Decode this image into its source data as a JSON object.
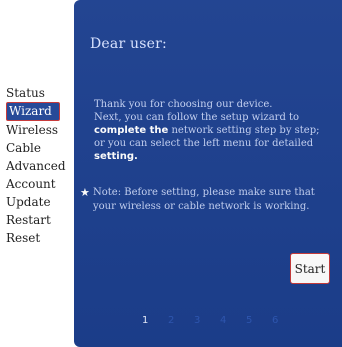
{
  "sidebar": {
    "items": [
      {
        "label": "Status"
      },
      {
        "label": "Wizard",
        "active": true
      },
      {
        "label": "Wireless"
      },
      {
        "label": "Cable"
      },
      {
        "label": "Advanced"
      },
      {
        "label": "Account"
      },
      {
        "label": "Update"
      },
      {
        "label": "Restart"
      },
      {
        "label": "Reset"
      }
    ]
  },
  "panel": {
    "greeting": "Dear user:",
    "intro": {
      "line1": "Thank you for choosing our device.",
      "line2": "Next, you can follow the setup wizard to",
      "bold1": "complete the",
      "line3_rest": " network setting step by step;",
      "line4": "or you can select the left menu for detailed",
      "bold2": "setting."
    },
    "note": {
      "icon": "star-icon",
      "text": "Note: Before setting, please make sure that your wireless or cable network is working."
    },
    "start_label": "Start",
    "pages": [
      "1",
      "2",
      "3",
      "4",
      "5",
      "6"
    ],
    "current_page": "1"
  },
  "colors": {
    "panel_bg": "#1c3f8e",
    "active_item_bg": "#274a98",
    "highlight_border": "#c83b3b",
    "inactive_page": "#2f58b4"
  }
}
